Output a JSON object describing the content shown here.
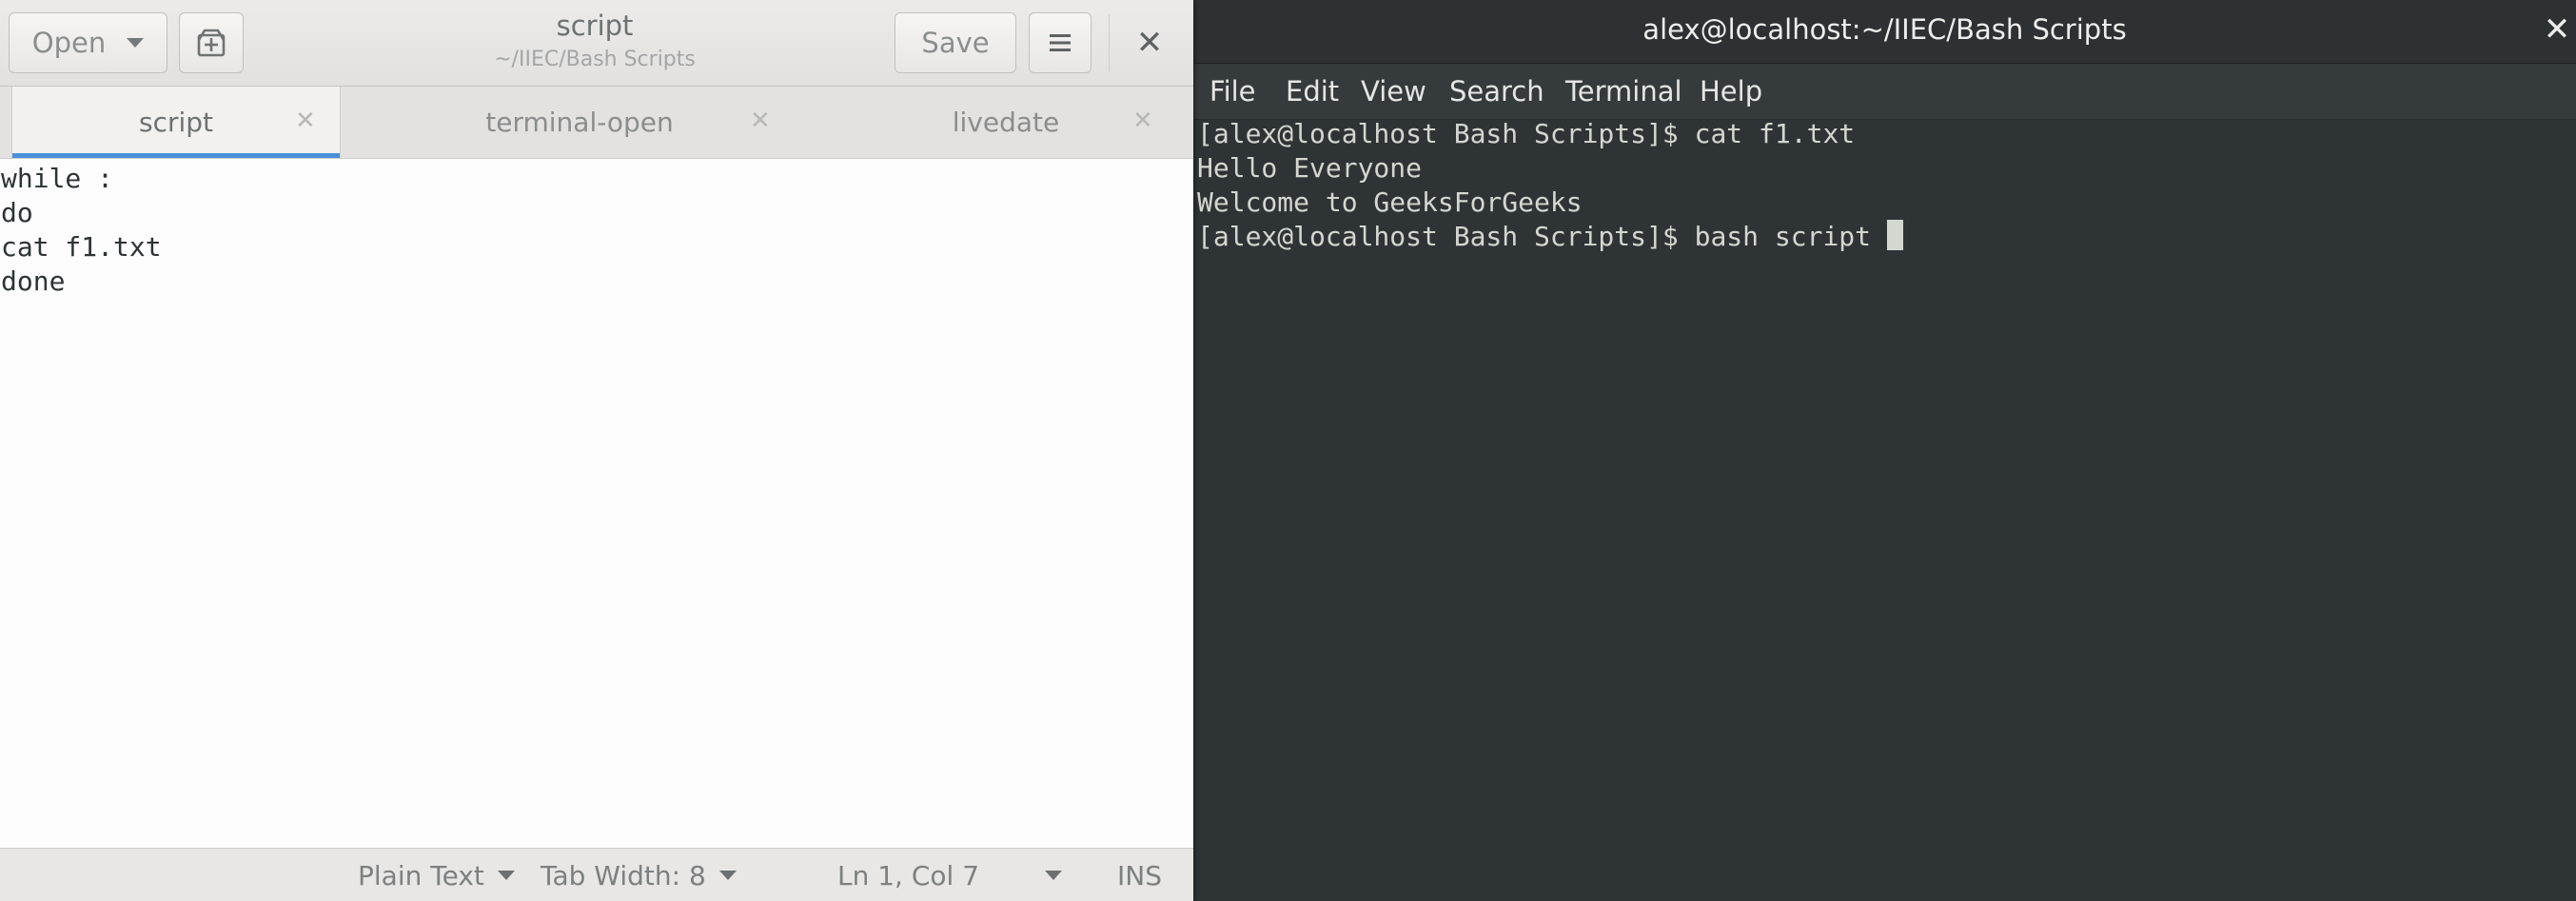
{
  "editor": {
    "title": "script",
    "subtitle": "~/IIEC/Bash Scripts",
    "open_label": "Open",
    "save_label": "Save",
    "tabs": [
      {
        "label": "script",
        "active": true
      },
      {
        "label": "terminal-open",
        "active": false
      },
      {
        "label": "livedate",
        "active": false
      }
    ],
    "lines": [
      "while :",
      "do",
      "cat f1.txt",
      "done"
    ],
    "statusbar": {
      "language": "Plain Text",
      "tab_width": "Tab Width: 8",
      "position": "Ln 1, Col 7",
      "mode": "INS"
    }
  },
  "terminal": {
    "title": "alex@localhost:~/IIEC/Bash Scripts",
    "menu": [
      "File",
      "Edit",
      "View",
      "Search",
      "Terminal",
      "Help"
    ],
    "lines": [
      "[alex@localhost Bash Scripts]$ cat f1.txt",
      "Hello Everyone",
      "Welcome to GeeksForGeeks",
      "[alex@localhost Bash Scripts]$ bash script "
    ]
  },
  "icons": {
    "close": "close-icon",
    "new_document": "new-document-icon",
    "hamburger": "hamburger-menu-icon",
    "dropdown": "chevron-down-icon"
  },
  "colors": {
    "tab_indicator": "#4a90d9",
    "terminal_bg": "#2e3436",
    "terminal_fg": "#d3d7cf"
  }
}
